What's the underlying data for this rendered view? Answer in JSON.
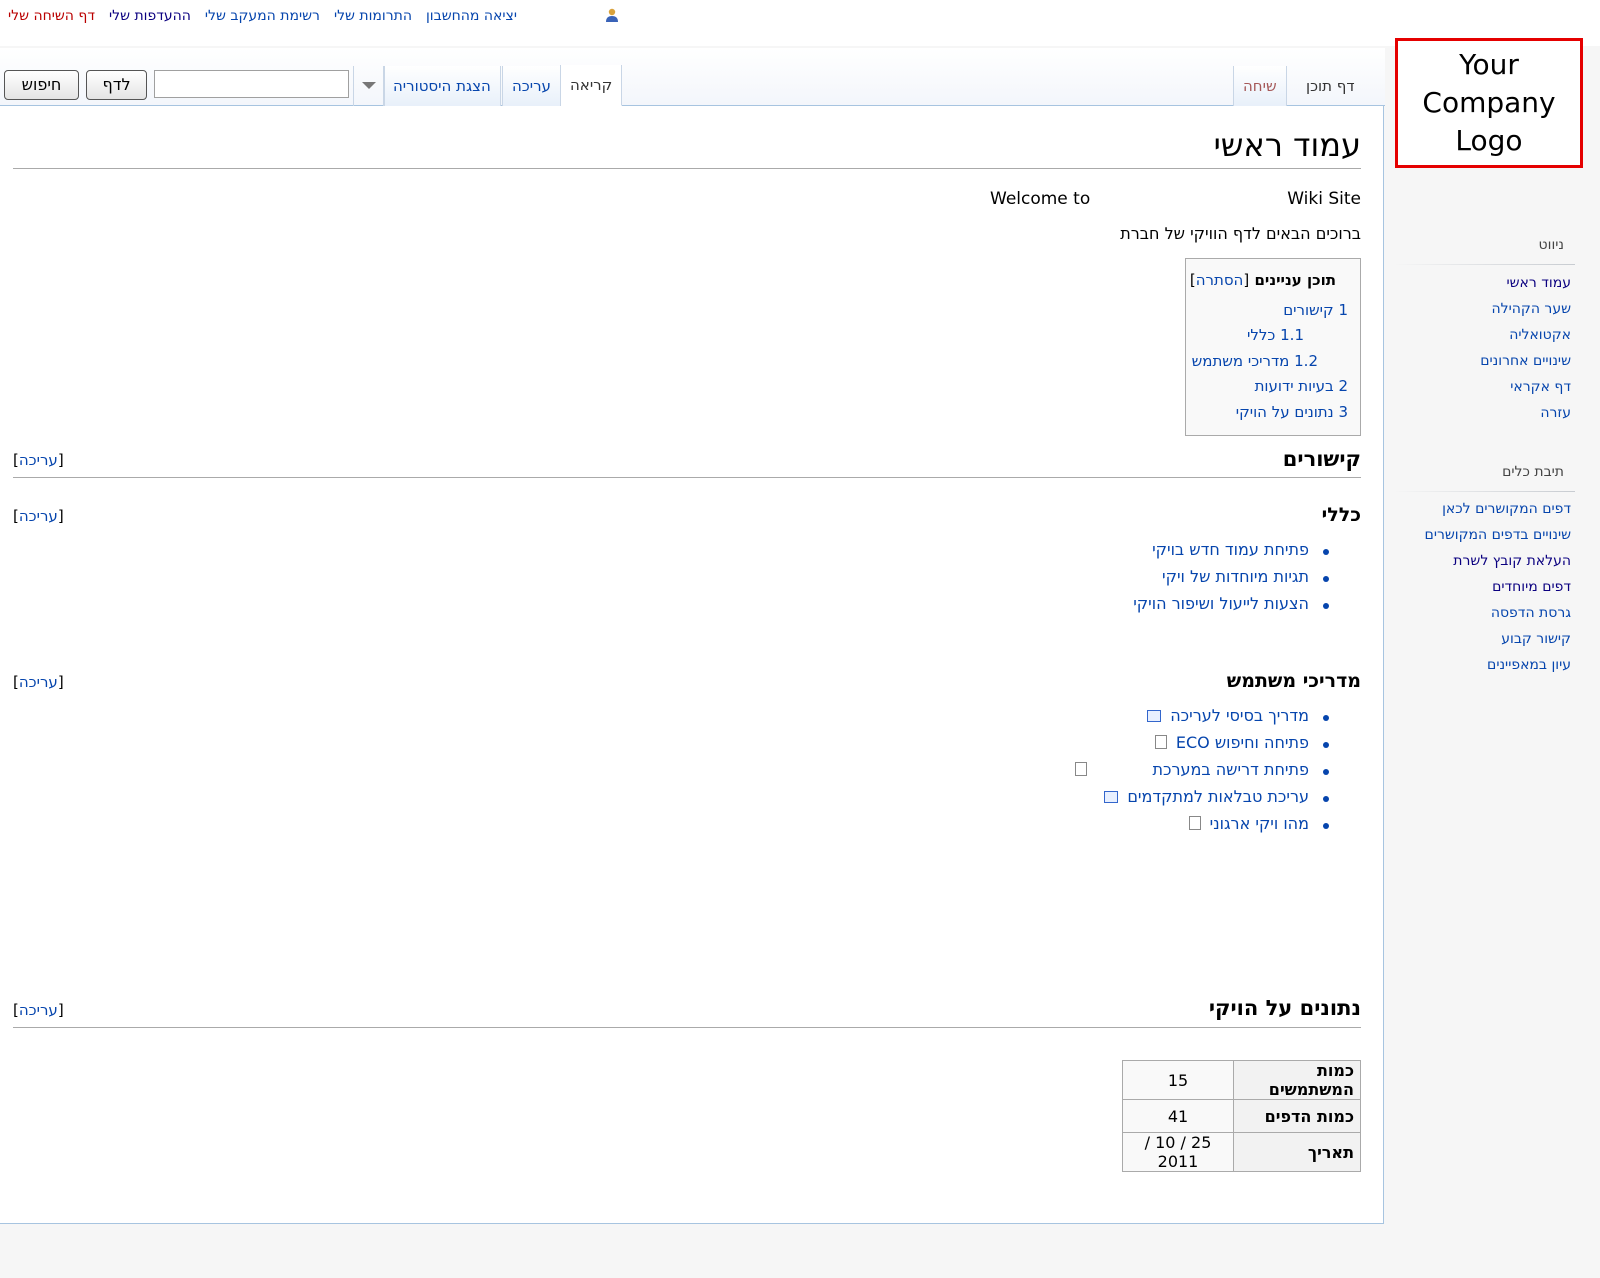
{
  "personal": {
    "items": [
      {
        "label": "דף השיחה שלי",
        "class": "red-link"
      },
      {
        "label": "ההעדפות שלי",
        "class": "dark"
      },
      {
        "label": "רשימת המעקב שלי",
        "class": ""
      },
      {
        "label": "התרומות שלי",
        "class": ""
      },
      {
        "label": "יציאה מהחשבון",
        "class": ""
      }
    ],
    "user_icon": "user-icon"
  },
  "tabs": {
    "page": "דף תוכן",
    "talk": "שיחה",
    "read": "קריאה",
    "edit": "עריכה",
    "history": "הצגת היסטוריה",
    "go_button": "לדף",
    "search_button": "חיפוש",
    "search_value": ""
  },
  "logo": {
    "text": "Your\nCompany\nLogo"
  },
  "content": {
    "title": "עמוד ראשי",
    "welcome_left": "Welcome to",
    "welcome_right": "Wiki Site",
    "intro": "ברוכים הבאים לדף הוויקי של חברת",
    "toc": {
      "title": "תוכן עניינים",
      "hide": "הסתרה",
      "items": [
        "1 קישורים",
        "1.1 כללי",
        "1.2 מדריכי משתמש",
        "2 בעיות ידועות",
        "3 נתונים על הויקי"
      ]
    },
    "edit_label": "עריכה",
    "sections": {
      "links": "קישורים",
      "general": "כללי",
      "guides": "מדריכי משתמש",
      "data": "נתונים על הויקי"
    },
    "general_items": [
      "פתיחת עמוד חדש בויקי",
      "תגיות מיוחדות של ויקי",
      "הצעות לייעול ושיפור הויקי"
    ],
    "guide_items": [
      {
        "label": "מדריך בסיסי לעריכה",
        "icon": "external-link-icon"
      },
      {
        "label": "פתיחה וחיפוש ECO",
        "icon": "document-icon"
      },
      {
        "label": "פתיחת דרישה במערכת",
        "icon": "document-icon"
      },
      {
        "label": "עריכת טבלאות למתקדמים",
        "icon": "external-link-icon"
      },
      {
        "label": "מהו ויקי ארגוני",
        "icon": "document-icon"
      }
    ],
    "stats": [
      {
        "label": "כמות המשתמשים",
        "value": "15"
      },
      {
        "label": "כמות הדפים",
        "value": "41"
      },
      {
        "label": "תאריך",
        "value": "25 / 10 / 2011"
      }
    ]
  },
  "sidebar": {
    "nav_title": "ניווט",
    "nav_items": [
      {
        "label": "עמוד ראשי",
        "class": "dark"
      },
      {
        "label": "שער הקהילה",
        "class": ""
      },
      {
        "label": "אקטואליה",
        "class": ""
      },
      {
        "label": "שינויים אחרונים",
        "class": ""
      },
      {
        "label": "דף אקראי",
        "class": ""
      },
      {
        "label": "עזרה",
        "class": ""
      }
    ],
    "tools_title": "תיבת כלים",
    "tool_items": [
      {
        "label": "דפים המקושרים לכאן",
        "class": ""
      },
      {
        "label": "שינויים בדפים המקושרים",
        "class": ""
      },
      {
        "label": "העלאת קובץ לשרת",
        "class": "dark"
      },
      {
        "label": "דפים מיוחדים",
        "class": "dark"
      },
      {
        "label": "גרסת הדפסה",
        "class": ""
      },
      {
        "label": "קישור קבוע",
        "class": ""
      },
      {
        "label": "עיון במאפיינים",
        "class": ""
      }
    ]
  }
}
